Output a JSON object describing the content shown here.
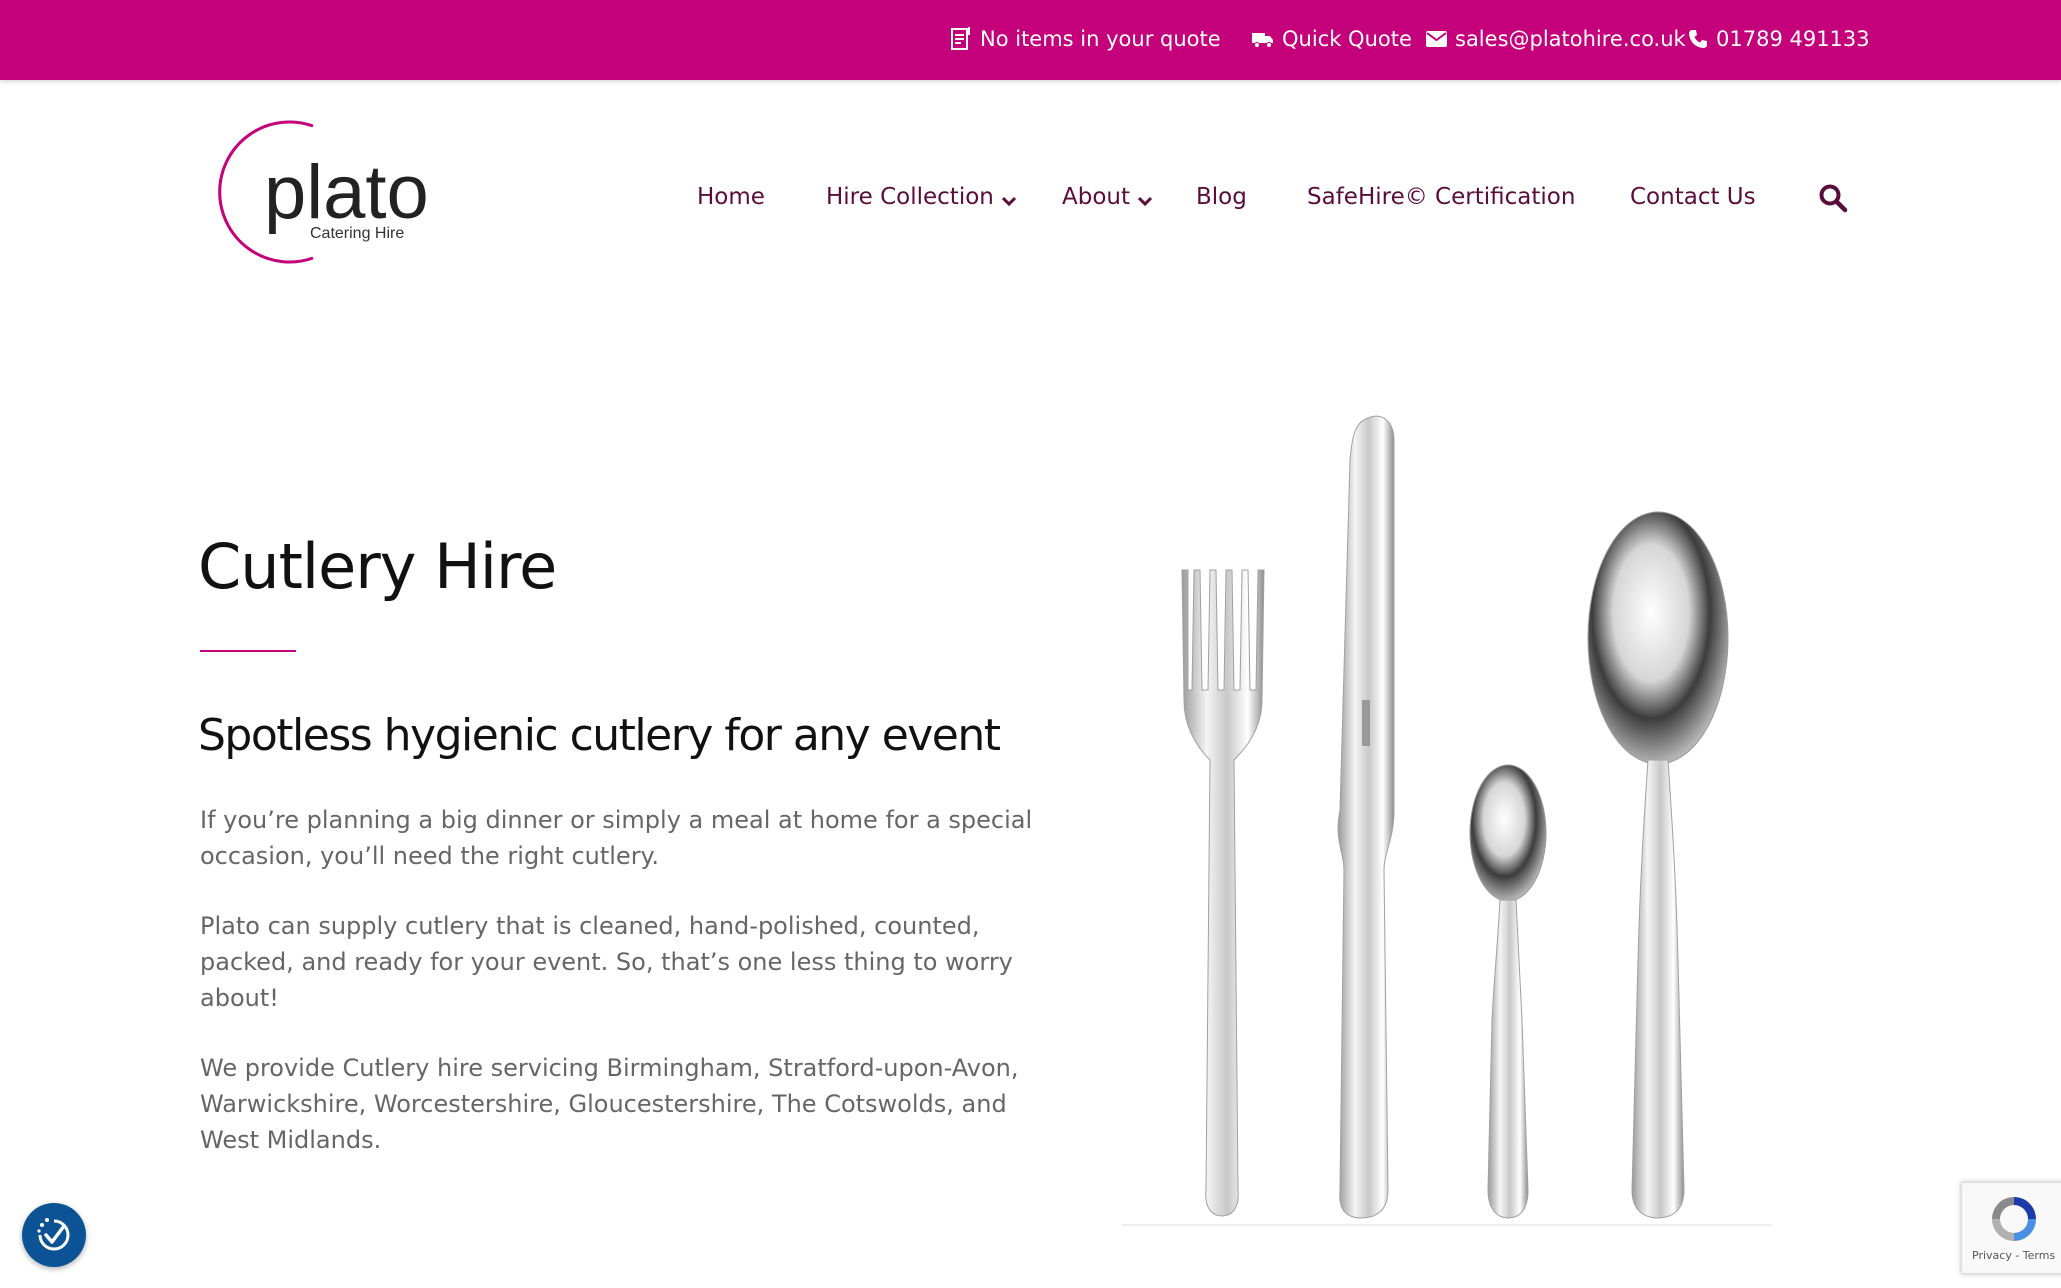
{
  "topbar": {
    "quote_status": "No items in your quote",
    "quick_quote": "Quick Quote",
    "email": "sales@platohire.co.uk",
    "phone": "01789 491133",
    "background_color": "#c4007a"
  },
  "logo": {
    "wordmark": "plato",
    "tagline": "Catering Hire"
  },
  "nav": {
    "items": [
      {
        "label": "Home"
      },
      {
        "label": "Hire Collection"
      },
      {
        "label": "About"
      },
      {
        "label": "Blog"
      },
      {
        "label": "SafeHire© Certification"
      },
      {
        "label": "Contact Us"
      }
    ],
    "text_color": "#5a0d3b"
  },
  "main": {
    "title": "Cutlery Hire",
    "subtitle": "Spotless hygienic cutlery for any event",
    "paragraphs": [
      "If you’re planning a big dinner or simply a meal at home for a special occasion, you’ll need the right cutlery.",
      "Plato can supply cutlery that is cleaned, hand-polished, counted, packed, and ready for your event. So, that’s one less thing to worry about!",
      "We provide Cutlery hire servicing Birmingham, Stratford-upon-Avon, Warwickshire, Worcestershire, Gloucestershire, The Cotswolds, and West Midlands."
    ]
  },
  "recaptcha": {
    "links": "Privacy - Terms"
  },
  "icons": [
    "quote-list-icon",
    "truck-icon",
    "envelope-icon",
    "phone-icon",
    "chevron-down-icon",
    "search-icon",
    "accessibility-icon",
    "recaptcha-icon"
  ]
}
